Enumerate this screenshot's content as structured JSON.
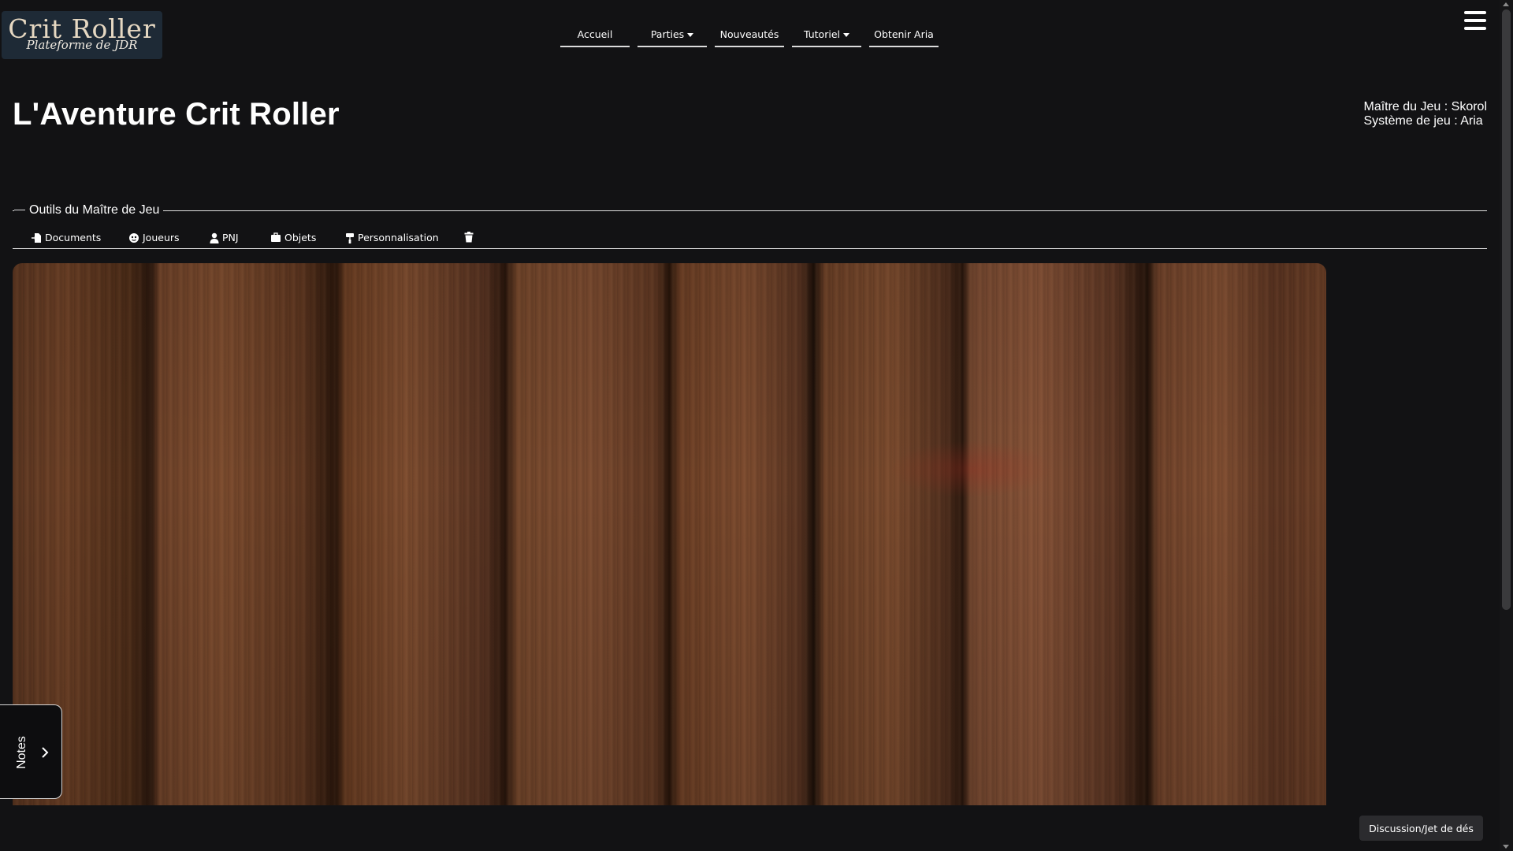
{
  "logo": {
    "title": "Crit Roller",
    "subtitle": "Plateforme de JDR"
  },
  "nav": {
    "items": [
      {
        "label": "Accueil",
        "has_dropdown": false
      },
      {
        "label": "Parties",
        "has_dropdown": true
      },
      {
        "label": "Nouveautés",
        "has_dropdown": false
      },
      {
        "label": "Tutoriel",
        "has_dropdown": true
      },
      {
        "label": "Obtenir Aria",
        "has_dropdown": false
      }
    ],
    "menu_icon": "hamburger-icon"
  },
  "game": {
    "title": "L'Aventure Crit Roller",
    "game_master": "Maître du Jeu : Skorol",
    "system": "Système de jeu : Aria"
  },
  "gm_tools": {
    "legend": "Outils du Maître de Jeu",
    "items": [
      {
        "label": "Documents",
        "icon": "document-icon"
      },
      {
        "label": "Joueurs",
        "icon": "players-icon"
      },
      {
        "label": "PNJ",
        "icon": "user-icon"
      },
      {
        "label": "Objets",
        "icon": "briefcase-icon"
      },
      {
        "label": "Personnalisation",
        "icon": "paint-roller-icon"
      },
      {
        "label": "",
        "icon": "trash-icon"
      }
    ]
  },
  "board": {
    "background": "wood-planks-texture"
  },
  "notes": {
    "label": "Notes",
    "icon": "chevron-right-icon"
  },
  "chat": {
    "label": "Discussion/Jet de dés"
  },
  "colors": {
    "background": "#121214",
    "logo_bg": "#1e2a36",
    "text": "#ffffff",
    "chat_button_bg": "#2b2b2e"
  }
}
